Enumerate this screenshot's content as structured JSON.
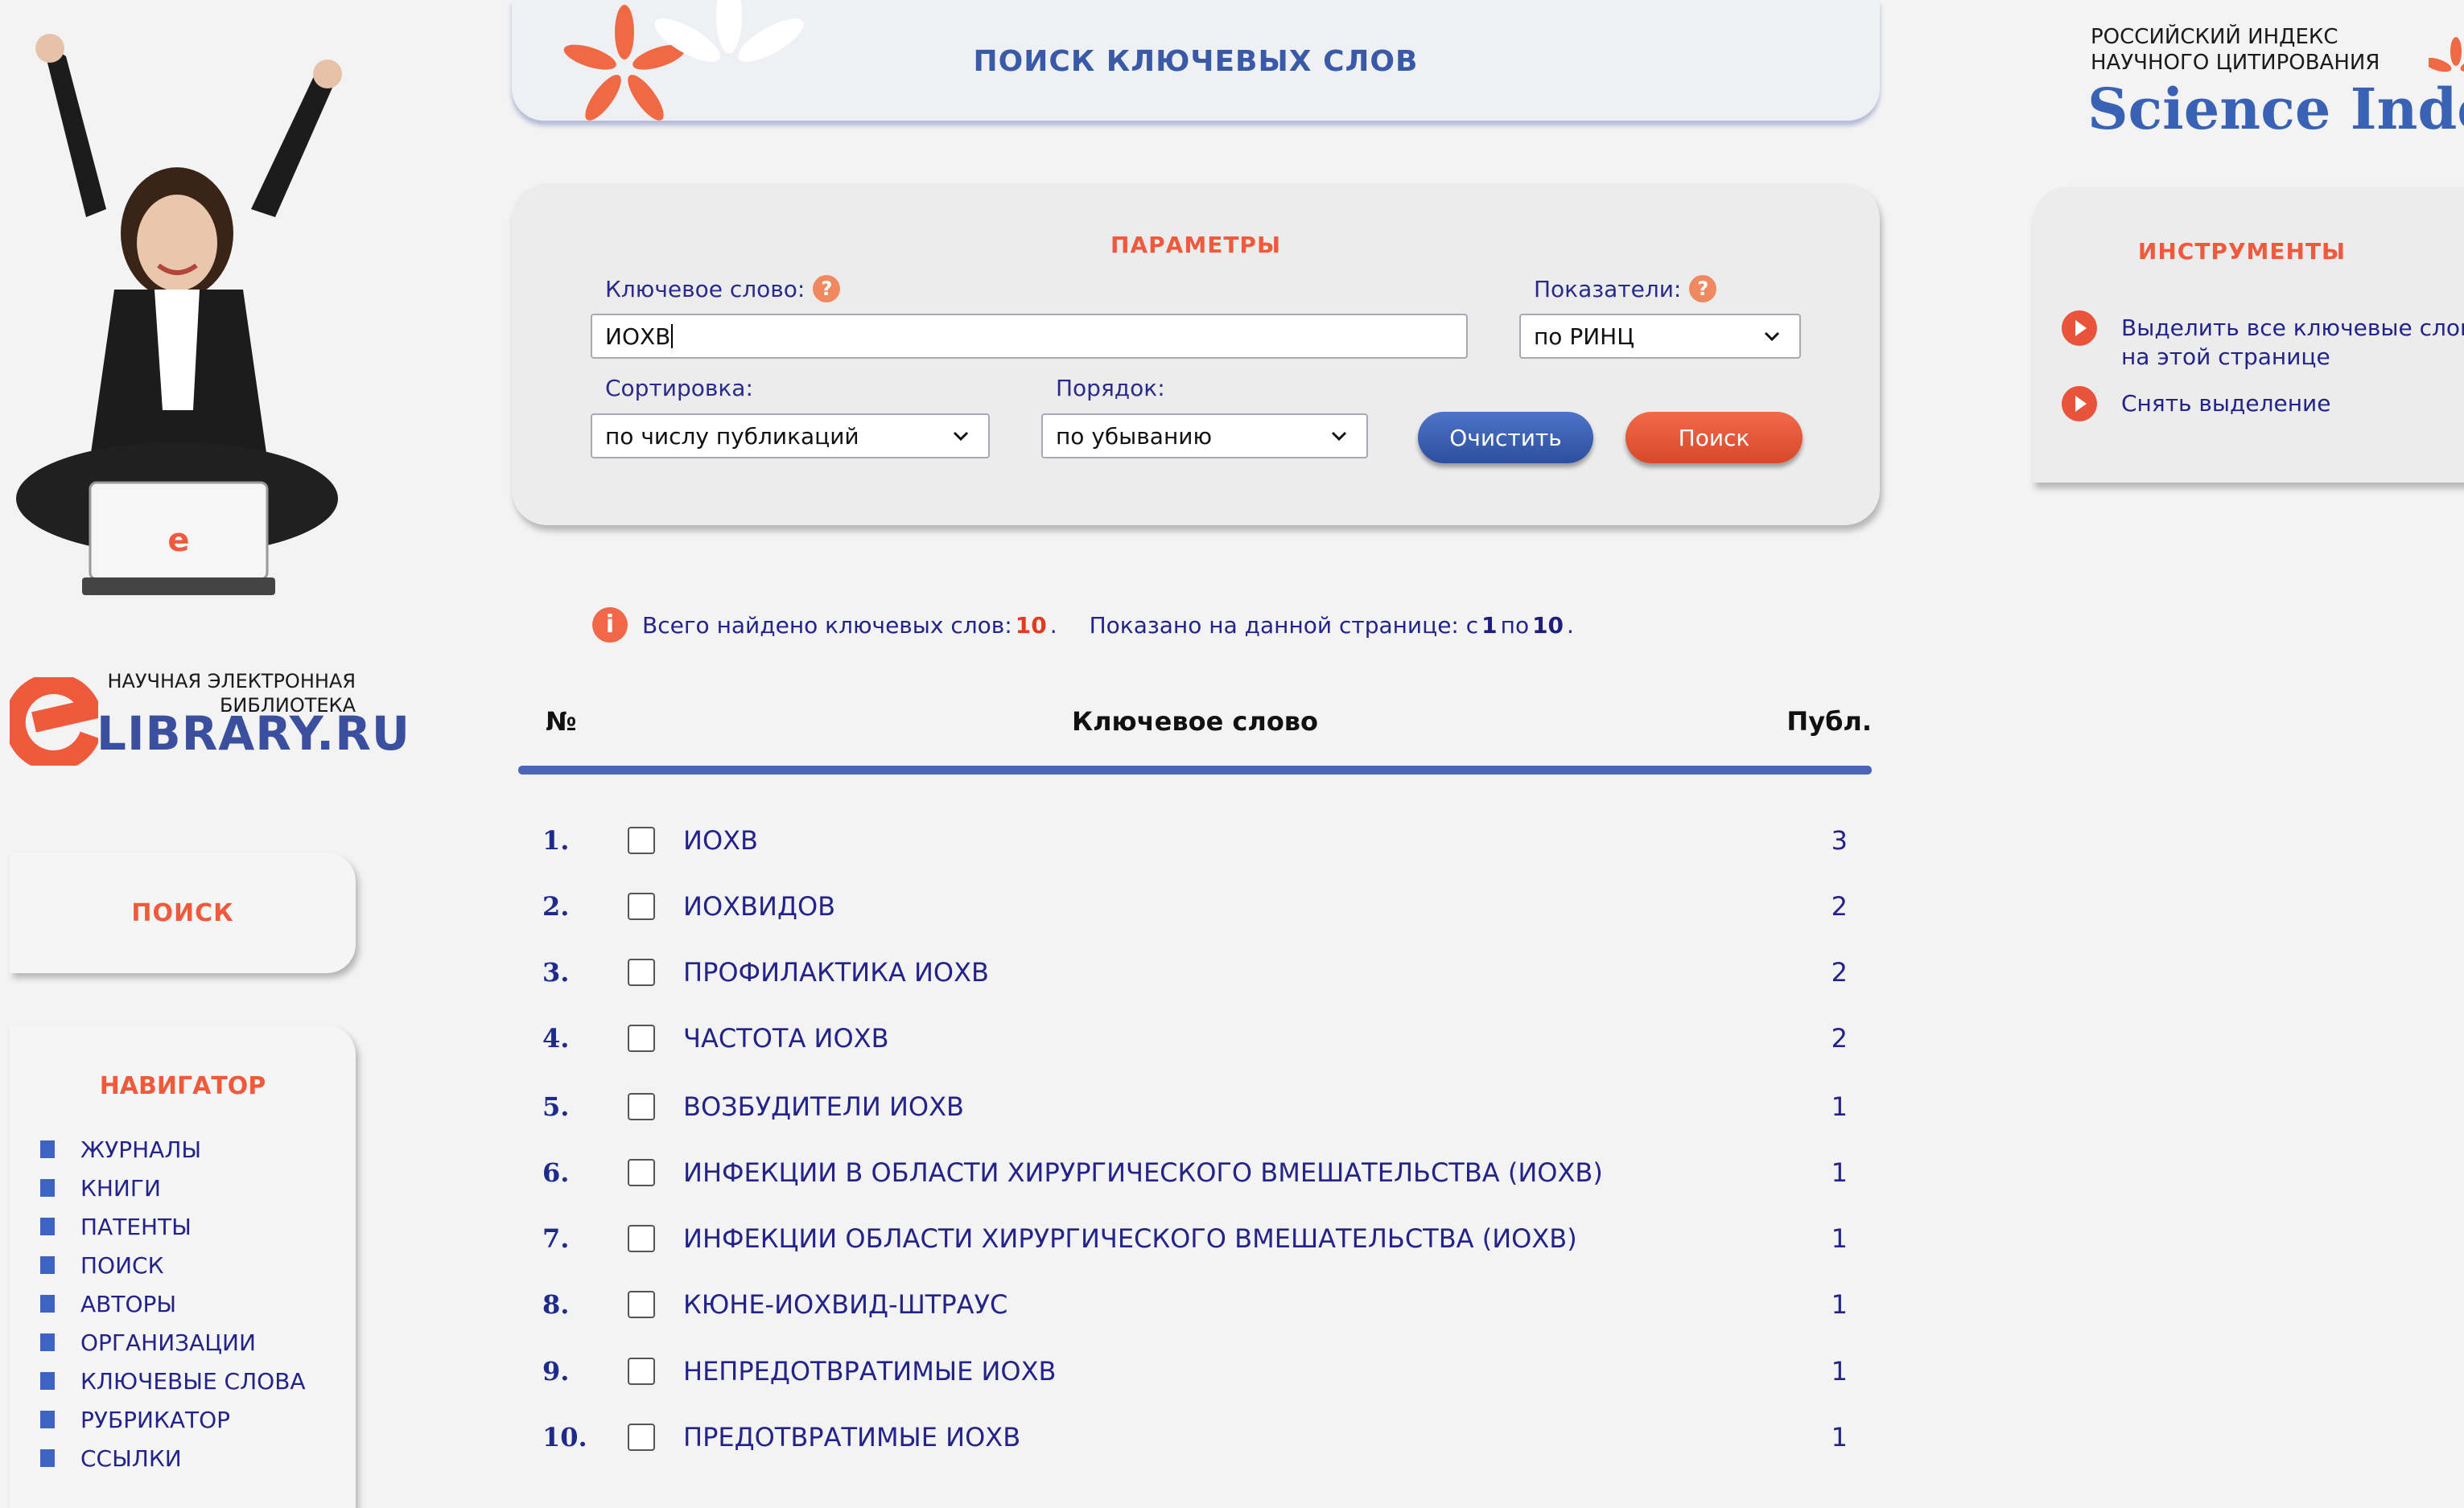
{
  "header": {
    "title": "ПОИСК КЛЮЧЕВЫХ СЛОВ"
  },
  "brand": {
    "elibrary_line1": "НАУЧНАЯ ЭЛЕКТРОННАЯ",
    "elibrary_line2": "БИБЛИОТЕКА",
    "elibrary_name": "LIBRARY.RU",
    "science_index_line1": "РОССИЙСКИЙ ИНДЕКС",
    "science_index_line2": "НАУЧНОГО ЦИТИРОВАНИЯ",
    "science_index_name": "Science Index"
  },
  "left": {
    "search_label": "ПОИСК",
    "navigator_title": "НАВИГАТОР",
    "nav_items": [
      "ЖУРНАЛЫ",
      "КНИГИ",
      "ПАТЕНТЫ",
      "ПОИСК",
      "АВТОРЫ",
      "ОРГАНИЗАЦИИ",
      "КЛЮЧЕВЫЕ СЛОВА",
      "РУБРИКАТОР",
      "ССЫЛКИ"
    ]
  },
  "params": {
    "title": "ПАРАМЕТРЫ",
    "keyword_label": "Ключевое слово:",
    "keyword_value": "ИОХВ",
    "indicators_label": "Показатели:",
    "indicators_value": "по РИНЦ",
    "sort_label": "Сортировка:",
    "sort_value": "по числу публикаций",
    "order_label": "Порядок:",
    "order_value": "по убыванию",
    "clear_label": "Очистить",
    "search_label": "Поиск",
    "help_glyph": "?"
  },
  "info": {
    "found_prefix": "Всего найдено ключевых слов:",
    "found_count": "10",
    "shown_prefix": "Показано на данной странице: с",
    "from": "1",
    "to_word": "по",
    "to": "10"
  },
  "table": {
    "col_num": "№",
    "col_keyword": "Ключевое слово",
    "col_pub": "Публ.",
    "rows": [
      {
        "n": "1.",
        "kw": "ИОХВ",
        "pub": "3"
      },
      {
        "n": "2.",
        "kw": "ИОХВИДОВ",
        "pub": "2"
      },
      {
        "n": "3.",
        "kw": "ПРОФИЛАКТИКА ИОХВ",
        "pub": "2"
      },
      {
        "n": "4.",
        "kw": "ЧАСТОТА ИОХВ",
        "pub": "2"
      },
      {
        "n": "5.",
        "kw": "ВОЗБУДИТЕЛИ ИОХВ",
        "pub": "1"
      },
      {
        "n": "6.",
        "kw": "ИНФЕКЦИИ В ОБЛАСТИ ХИРУРГИЧЕСКОГО ВМЕШАТЕЛЬСТВА (ИОХВ)",
        "pub": "1"
      },
      {
        "n": "7.",
        "kw": "ИНФЕКЦИИ ОБЛАСТИ ХИРУРГИЧЕСКОГО ВМЕШАТЕЛЬСТВА (ИОХВ)",
        "pub": "1"
      },
      {
        "n": "8.",
        "kw": "КЮНЕ-ИОХВИД-ШТРАУС",
        "pub": "1"
      },
      {
        "n": "9.",
        "kw": "НЕПРЕДОТВРАТИМЫЕ ИОХВ",
        "pub": "1"
      },
      {
        "n": "10.",
        "kw": "ПРЕДОТВРАТИМЫЕ ИОХВ",
        "pub": "1"
      }
    ]
  },
  "tools": {
    "title": "ИНСТРУМЕНТЫ",
    "select_all_line1": "Выделить все ключевые слов",
    "select_all_line2": "на этой странице",
    "deselect": "Снять выделение"
  },
  "colors": {
    "accent": "#ef5a3c",
    "link": "#23238a",
    "brand_blue": "#3a62b4"
  }
}
